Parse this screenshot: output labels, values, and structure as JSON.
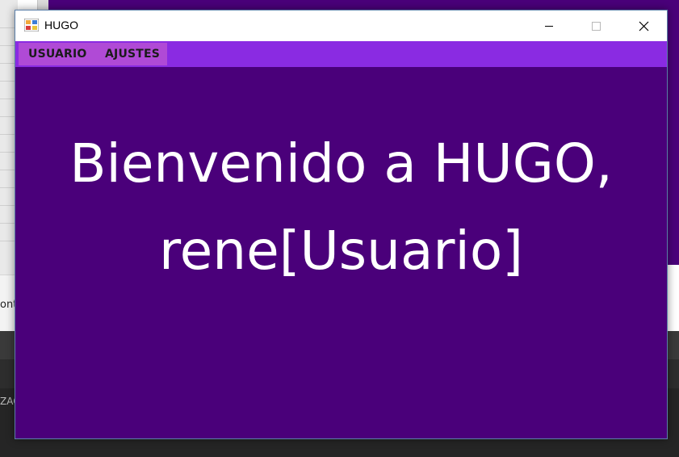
{
  "background": {
    "fragment_left": "ont",
    "fragment_dark": "ZAC"
  },
  "window": {
    "title": "HUGO",
    "icon": "app-icon",
    "controls": {
      "minimize_icon": "minimize-icon",
      "maximize_icon": "maximize-icon",
      "close_icon": "close-icon"
    }
  },
  "menu": {
    "items": [
      {
        "label": "USUARIO"
      },
      {
        "label": "AJUSTES"
      }
    ]
  },
  "main": {
    "welcome_line1": "Bienvenido a HUGO,",
    "welcome_line2": "rene[Usuario]"
  },
  "colors": {
    "window_background": "#4a007a",
    "menubar": "#8a2be2",
    "menu_highlight": "#b04ad6",
    "text": "#ffffff"
  }
}
